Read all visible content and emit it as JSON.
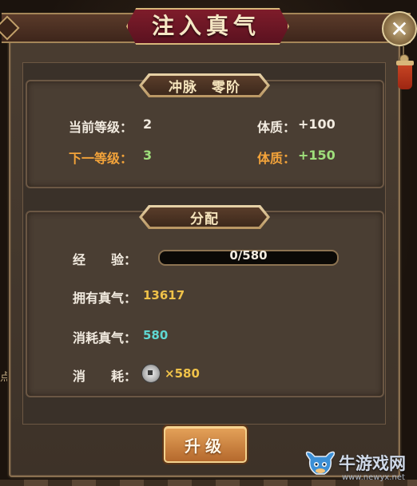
{
  "title": "注入真气",
  "section_top": {
    "label": "冲脉　零阶",
    "current_level_label": "当前等级：",
    "current_level_value": "2",
    "current_stat_label": "体质：",
    "current_stat_value": "+100",
    "next_level_label": "下一等级：",
    "next_level_value": "3",
    "next_stat_label": "体质：",
    "next_stat_value": "+150"
  },
  "section_allocate": {
    "label": "分配",
    "exp_label": "经　　验：",
    "exp_progress_text": "0/580",
    "exp_progress_fraction": 0,
    "owned_label": "拥有真气：",
    "owned_value": "13617",
    "cost_label": "消耗真气：",
    "cost_value": "580",
    "consume_label": "消　　耗：",
    "consume_icon": "copper-coin-icon",
    "consume_value": "×580"
  },
  "upgrade_button_label": "升级",
  "left_edge_hint": "点",
  "watermark": {
    "main": "牛游戏网",
    "sub": "www.newyx.net"
  },
  "colors": {
    "orange": "#f3a33a",
    "green": "#9fe07c",
    "gold": "#f0c249",
    "cyan": "#5fd8d3"
  }
}
